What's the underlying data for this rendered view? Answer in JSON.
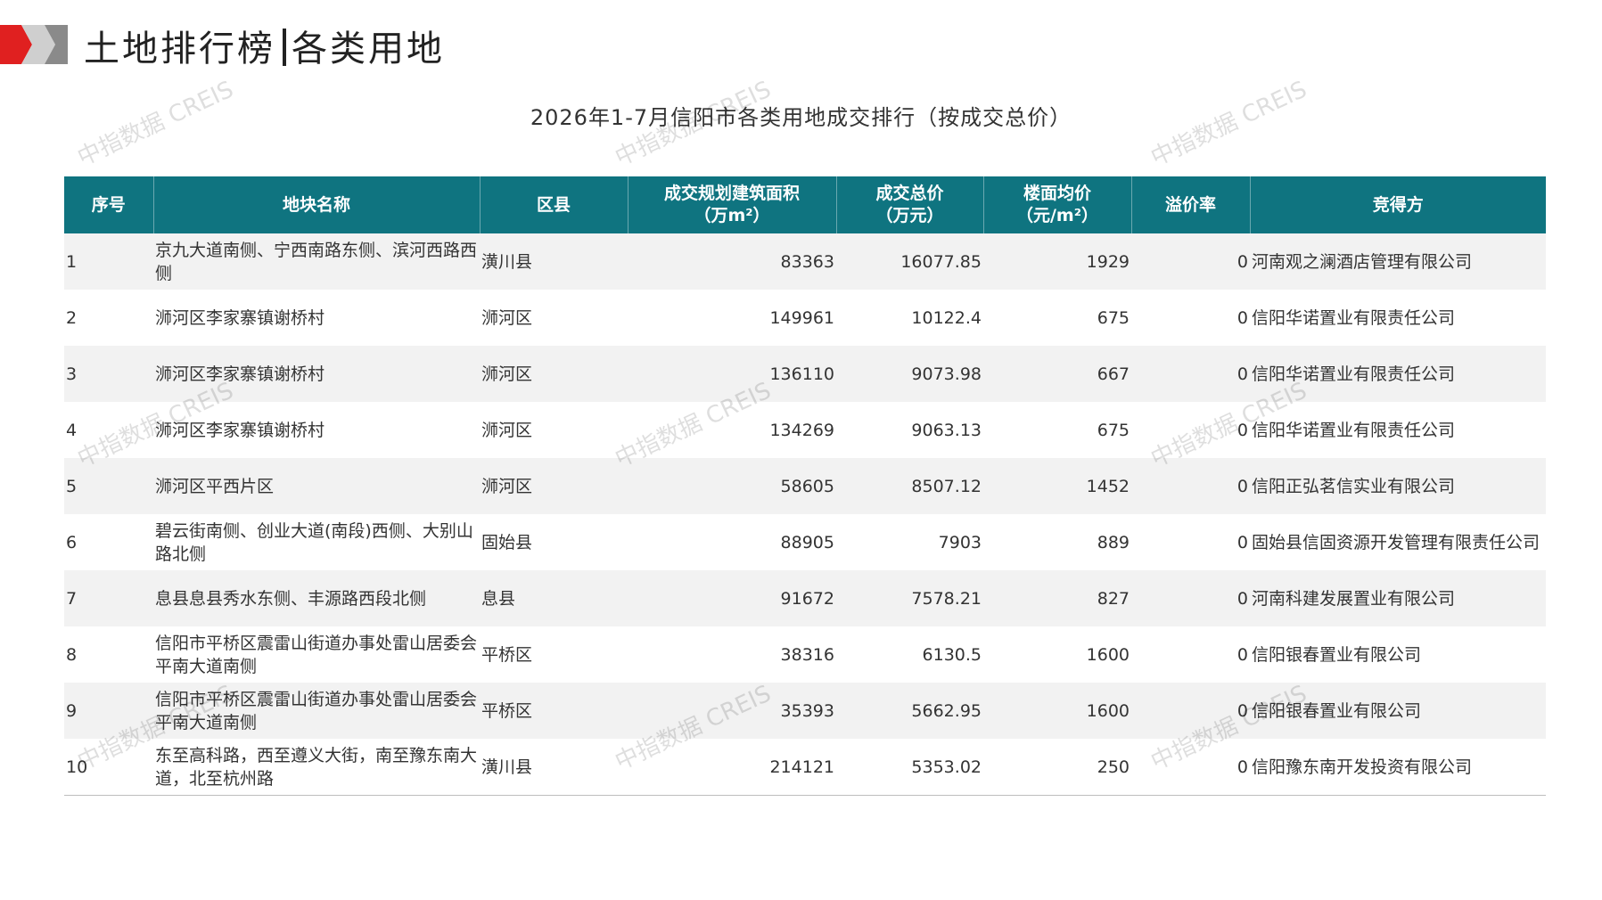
{
  "header": {
    "title_part1": "土地排行榜",
    "title_part2": "各类用地"
  },
  "table_title": "2026年1-7月信阳市各类用地成交排行（按成交总价）",
  "watermark_text": "中指数据 CREIS",
  "colors": {
    "header_bg": "#0f7480",
    "price_text": "#c00000",
    "logo_red": "#e02020",
    "logo_gray": "#8a8a8a"
  },
  "columns": [
    {
      "l1": "序号",
      "l2": ""
    },
    {
      "l1": "地块名称",
      "l2": ""
    },
    {
      "l1": "区县",
      "l2": ""
    },
    {
      "l1": "成交规划建筑面积",
      "l2": "（万m²）"
    },
    {
      "l1": "成交总价",
      "l2": "（万元）"
    },
    {
      "l1": "楼面均价",
      "l2": "（元/m²）"
    },
    {
      "l1": "溢价率",
      "l2": ""
    },
    {
      "l1": "竞得方",
      "l2": ""
    }
  ],
  "rows": [
    {
      "no": "1",
      "name": "京九大道南侧、宁西南路东侧、滨河西路西侧",
      "district": "潢川县",
      "area": "83363",
      "total": "16077.85",
      "unit_price": "1929",
      "premium": "0",
      "buyer": "河南观之澜酒店管理有限公司"
    },
    {
      "no": "2",
      "name": "浉河区李家寨镇谢桥村",
      "district": "浉河区",
      "area": "149961",
      "total": "10122.4",
      "unit_price": "675",
      "premium": "0",
      "buyer": "信阳华诺置业有限责任公司"
    },
    {
      "no": "3",
      "name": "浉河区李家寨镇谢桥村",
      "district": "浉河区",
      "area": "136110",
      "total": "9073.98",
      "unit_price": "667",
      "premium": "0",
      "buyer": "信阳华诺置业有限责任公司"
    },
    {
      "no": "4",
      "name": "浉河区李家寨镇谢桥村",
      "district": "浉河区",
      "area": "134269",
      "total": "9063.13",
      "unit_price": "675",
      "premium": "0",
      "buyer": "信阳华诺置业有限责任公司"
    },
    {
      "no": "5",
      "name": "浉河区平西片区",
      "district": "浉河区",
      "area": "58605",
      "total": "8507.12",
      "unit_price": "1452",
      "premium": "0",
      "buyer": "信阳正弘茗信实业有限公司"
    },
    {
      "no": "6",
      "name": "碧云街南侧、创业大道(南段)西侧、大别山路北侧",
      "district": "固始县",
      "area": "88905",
      "total": "7903",
      "unit_price": "889",
      "premium": "0",
      "buyer": "固始县信固资源开发管理有限责任公司"
    },
    {
      "no": "7",
      "name": "息县息县秀水东侧、丰源路西段北侧",
      "district": "息县",
      "area": "91672",
      "total": "7578.21",
      "unit_price": "827",
      "premium": "0",
      "buyer": "河南科建发展置业有限公司"
    },
    {
      "no": "8",
      "name": "信阳市平桥区震雷山街道办事处雷山居委会平南大道南侧",
      "district": "平桥区",
      "area": "38316",
      "total": "6130.5",
      "unit_price": "1600",
      "premium": "0",
      "buyer": "信阳银春置业有限公司"
    },
    {
      "no": "9",
      "name": "信阳市平桥区震雷山街道办事处雷山居委会平南大道南侧",
      "district": "平桥区",
      "area": "35393",
      "total": "5662.95",
      "unit_price": "1600",
      "premium": "0",
      "buyer": "信阳银春置业有限公司"
    },
    {
      "no": "10",
      "name": "东至高科路，西至遵义大街，南至豫东南大道，北至杭州路",
      "district": "潢川县",
      "area": "214121",
      "total": "5353.02",
      "unit_price": "250",
      "premium": "0",
      "buyer": "信阳豫东南开发投资有限公司"
    }
  ]
}
